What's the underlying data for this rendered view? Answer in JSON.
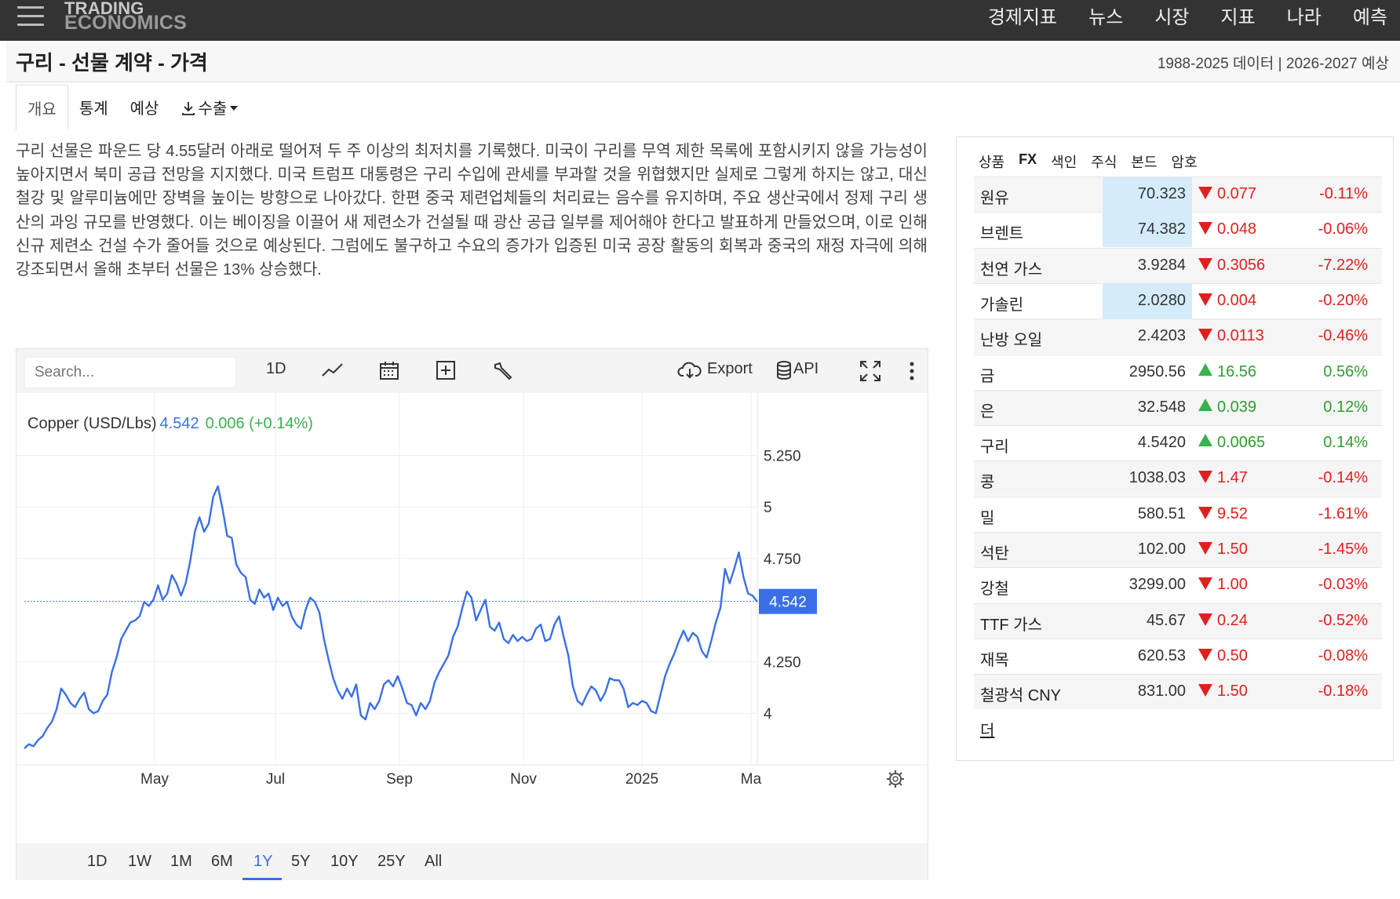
{
  "header": {
    "logo_line1": "TRADING",
    "logo_line2": "ECONOMICS",
    "nav": [
      "경제지표",
      "뉴스",
      "시장",
      "지표",
      "나라",
      "예측"
    ]
  },
  "titlebar": {
    "title": "구리 - 선물 계약 - 가격",
    "data_range": "1988-2025 데이터 | 2026-2027 예상"
  },
  "tabs": {
    "overview": "개요",
    "stats": "통계",
    "forecast": "예상",
    "export": "수출"
  },
  "description": "구리 선물은 파운드 당 4.55달러 아래로 떨어져 두 주 이상의 최저치를 기록했다. 미국이 구리를 무역 제한 목록에 포함시키지 않을 가능성이 높아지면서 북미 공급 전망을 지지했다. 미국 트럼프 대통령은 구리 수입에 관세를 부과할 것을 위협했지만 실제로 그렇게 하지는 않고, 대신 철강 및 알루미늄에만 장벽을 높이는 방향으로 나아갔다. 한편 중국 제련업체들의 처리료는 음수를 유지하며, 주요 생산국에서 정제 구리 생산의 과잉 규모를 반영했다. 이는 베이징을 이끌어 새 제련소가 건설될 때 광산 공급 일부를 제어해야 한다고 발표하게 만들었으며, 이로 인해 신규 제련소 건설 수가 줄어들 것으로 예상된다. 그럼에도 불구하고 수요의 증가가 입증된 미국 공장 활동의 회복과 중국의 재정 자극에 의해 강조되면서 올해 초부터 선물은 13% 상승했다.",
  "chart_toolbar": {
    "search_placeholder": "Search...",
    "interval": "1D",
    "export_label": "Export",
    "api_label": "API"
  },
  "chart_legend": {
    "symbol": "Copper (USD/Lbs)",
    "price": "4.542",
    "change": "0.006 (+0.14%)"
  },
  "chart_data": {
    "type": "line",
    "series": [
      {
        "name": "Copper (USD/Lbs)",
        "values": [
          3.83,
          3.85,
          3.84,
          3.87,
          3.89,
          3.93,
          3.96,
          4.02,
          4.12,
          4.09,
          4.05,
          4.03,
          4.07,
          4.1,
          4.02,
          4.0,
          4.01,
          4.06,
          4.09,
          4.2,
          4.27,
          4.36,
          4.4,
          4.44,
          4.45,
          4.47,
          4.54,
          4.52,
          4.55,
          4.62,
          4.55,
          4.58,
          4.67,
          4.63,
          4.57,
          4.63,
          4.74,
          4.88,
          4.95,
          4.88,
          4.92,
          5.05,
          5.1,
          4.99,
          4.86,
          4.85,
          4.72,
          4.68,
          4.66,
          4.55,
          4.53,
          4.6,
          4.56,
          4.58,
          4.5,
          4.56,
          4.52,
          4.54,
          4.47,
          4.43,
          4.41,
          4.5,
          4.56,
          4.54,
          4.49,
          4.36,
          4.26,
          4.17,
          4.11,
          4.07,
          4.12,
          4.08,
          4.14,
          3.99,
          3.97,
          4.05,
          4.02,
          4.06,
          4.14,
          4.16,
          4.13,
          4.18,
          4.12,
          4.05,
          4.04,
          3.99,
          4.05,
          4.02,
          4.06,
          4.15,
          4.2,
          4.24,
          4.28,
          4.37,
          4.42,
          4.51,
          4.59,
          4.56,
          4.45,
          4.5,
          4.55,
          4.42,
          4.4,
          4.44,
          4.36,
          4.34,
          4.38,
          4.35,
          4.37,
          4.35,
          4.36,
          4.41,
          4.43,
          4.35,
          4.36,
          4.43,
          4.47,
          4.37,
          4.28,
          4.13,
          4.06,
          4.04,
          4.09,
          4.13,
          4.11,
          4.06,
          4.1,
          4.17,
          4.16,
          4.16,
          4.12,
          4.03,
          4.05,
          4.04,
          4.06,
          4.05,
          4.01,
          4.0,
          4.09,
          4.18,
          4.24,
          4.29,
          4.35,
          4.4,
          4.35,
          4.39,
          4.37,
          4.3,
          4.27,
          4.35,
          4.44,
          4.51,
          4.7,
          4.63,
          4.7,
          4.78,
          4.66,
          4.58,
          4.57,
          4.54
        ]
      }
    ],
    "x_ticks": [
      "May",
      "Jul",
      "Sep",
      "Nov",
      "2025",
      "Ma"
    ],
    "y_ticks": [
      "4",
      "4.250",
      "4.750",
      "5",
      "5.250"
    ],
    "y_tick_values": [
      4,
      4.25,
      4.75,
      5,
      5.25
    ],
    "ylim": [
      3.75,
      5.4
    ],
    "last_value": "4.542",
    "line_color": "#3b6fe6"
  },
  "ranges": [
    "1D",
    "1W",
    "1M",
    "6M",
    "1Y",
    "5Y",
    "10Y",
    "25Y",
    "All"
  ],
  "active_range": "1Y",
  "market": {
    "tabs": [
      "상품",
      "FX",
      "색인",
      "주식",
      "본드",
      "암호"
    ],
    "rows": [
      {
        "name": "원유",
        "price": "70.323",
        "change": "0.077",
        "pct": "-0.11%",
        "dir": "down",
        "hl": true
      },
      {
        "name": "브렌트",
        "price": "74.382",
        "change": "0.048",
        "pct": "-0.06%",
        "dir": "down",
        "hl": true
      },
      {
        "name": "천연 가스",
        "price": "3.9284",
        "change": "0.3056",
        "pct": "-7.22%",
        "dir": "down",
        "hl": false
      },
      {
        "name": "가솔린",
        "price": "2.0280",
        "change": "0.004",
        "pct": "-0.20%",
        "dir": "down",
        "hl": true
      },
      {
        "name": "난방 오일",
        "price": "2.4203",
        "change": "0.0113",
        "pct": "-0.46%",
        "dir": "down",
        "hl": false
      },
      {
        "name": "금",
        "price": "2950.56",
        "change": "16.56",
        "pct": "0.56%",
        "dir": "up",
        "hl": false
      },
      {
        "name": "은",
        "price": "32.548",
        "change": "0.039",
        "pct": "0.12%",
        "dir": "up",
        "hl": false
      },
      {
        "name": "구리",
        "price": "4.5420",
        "change": "0.0065",
        "pct": "0.14%",
        "dir": "up",
        "hl": false
      },
      {
        "name": "콩",
        "price": "1038.03",
        "change": "1.47",
        "pct": "-0.14%",
        "dir": "down",
        "hl": false
      },
      {
        "name": "밀",
        "price": "580.51",
        "change": "9.52",
        "pct": "-1.61%",
        "dir": "down",
        "hl": false
      },
      {
        "name": "석탄",
        "price": "102.00",
        "change": "1.50",
        "pct": "-1.45%",
        "dir": "down",
        "hl": false
      },
      {
        "name": "강철",
        "price": "3299.00",
        "change": "1.00",
        "pct": "-0.03%",
        "dir": "down",
        "hl": false
      },
      {
        "name": "TTF 가스",
        "price": "45.67",
        "change": "0.24",
        "pct": "-0.52%",
        "dir": "down",
        "hl": false
      },
      {
        "name": "재목",
        "price": "620.53",
        "change": "0.50",
        "pct": "-0.08%",
        "dir": "down",
        "hl": false
      },
      {
        "name": "철광석 CNY",
        "price": "831.00",
        "change": "1.50",
        "pct": "-0.18%",
        "dir": "down",
        "hl": false
      }
    ],
    "more": "더"
  }
}
